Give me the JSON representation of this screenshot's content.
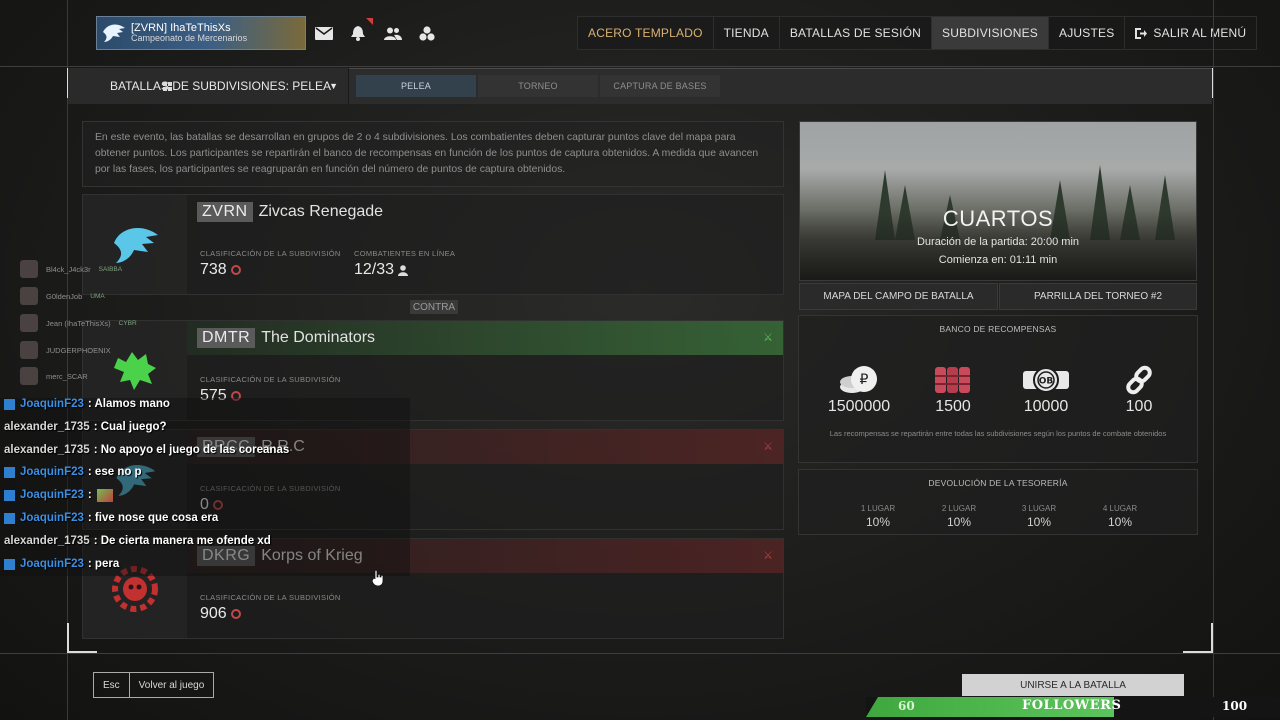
{
  "profile": {
    "nickname": "[ZVRN] IhaTeThisXs",
    "rank": "Campeonato de Mercenarios"
  },
  "nav": [
    "ACERO TEMPLADO",
    "TIENDA",
    "BATALLAS DE SESIÓN",
    "SUBDIVISIONES",
    "AJUSTES",
    "SALIR AL MENÚ"
  ],
  "event": {
    "dropdown": "BATALLAS DE SUBDIVISIONES: PELEA",
    "tabs": [
      "PELEA",
      "TORNEO",
      "CAPTURA DE BASES"
    ],
    "description": "En este evento, las batallas se desarrollan en grupos de 2 o 4 subdivisiones. Los combatientes deben capturar puntos clave del mapa para obtener puntos. Los participantes se repartirán el banco de recompensas en función de los puntos de captura obtenidos. A medida que avancen por las fases, los participantes se reagruparán en función del número de puntos de captura obtenidos."
  },
  "teams": [
    {
      "tag": "ZVRN",
      "name": "Zivcas Renegade",
      "rating_label": "CLASIFICACIÓN DE LA SUBDIVISIÓN",
      "rating": "738",
      "online_label": "COMBATIENTES EN LÍNEA",
      "online": "12/33"
    },
    {
      "tag": "DMTR",
      "name": "The Dominators",
      "rating_label": "CLASIFICACIÓN DE LA SUBDIVISIÓN",
      "rating": "575"
    },
    {
      "tag": "RRCC",
      "name": "R.R.C",
      "rating_label": "CLASIFICACIÓN DE LA SUBDIVISIÓN",
      "rating": "0"
    },
    {
      "tag": "DKRG",
      "name": "Korps of Krieg",
      "rating_label": "CLASIFICACIÓN DE LA SUBDIVISIÓN",
      "rating": "906"
    }
  ],
  "versus": "CONTRA",
  "stage": {
    "title": "CUARTOS",
    "duration": "Duración de la partida: 20:00 min",
    "start": "Comienza en: 01:11 min"
  },
  "buttons": {
    "map": "MAPA DEL CAMPO DE BATALLA",
    "bracket": "PARRILLA DEL TORNEO #2",
    "join": "UNIRSE A LA BATALLA"
  },
  "rewards": {
    "title": "BANCO DE RECOMPENSAS",
    "items": [
      {
        "icon": "coins-icon",
        "value": "1500000"
      },
      {
        "icon": "barrels-icon",
        "value": "1500"
      },
      {
        "icon": "ob-token-icon",
        "value": "10000"
      },
      {
        "icon": "chain-icon",
        "value": "100"
      }
    ],
    "note": "Las recompensas se repartirán entre todas las subdivisiones según los puntos de combate obtenidos"
  },
  "treasury": {
    "title": "DEVOLUCIÓN DE LA TESORERÍA",
    "places": [
      {
        "label": "1 LUGAR",
        "value": "10%"
      },
      {
        "label": "2 LUGAR",
        "value": "10%"
      },
      {
        "label": "3 LUGAR",
        "value": "10%"
      },
      {
        "label": "4 LUGAR",
        "value": "10%"
      }
    ]
  },
  "viewers": [
    {
      "name": "Bl4ck_J4ck3r",
      "badge": "SAIBBA"
    },
    {
      "name": "G0ldenJob",
      "badge": "UMA"
    },
    {
      "name": "Jean (IhaTeThisXs)",
      "badge": "CYBR"
    },
    {
      "name": "JUDGERPHOENIX",
      "badge": ""
    },
    {
      "name": "merc_SCAR",
      "badge": ""
    }
  ],
  "chat": [
    {
      "user": "JoaquinF23",
      "text": ": Alamos mano",
      "icon": true
    },
    {
      "user": "alexander_1735",
      "text": ": Cual juego?",
      "icon": false
    },
    {
      "user": "alexander_1735",
      "text": ": No apoyo el juego de las coreanas",
      "icon": false
    },
    {
      "user": "JoaquinF23",
      "text": ": ese no p",
      "icon": true
    },
    {
      "user": "JoaquinF23",
      "text": ":",
      "icon": true
    },
    {
      "user": "JoaquinF23",
      "text": ": five nose que cosa era",
      "icon": true
    },
    {
      "user": "alexander_1735",
      "text": ": De cierta manera me ofende xd",
      "icon": false
    },
    {
      "user": "JoaquinF23",
      "text": ": pera",
      "icon": true
    }
  ],
  "footer": {
    "esc": "Esc",
    "back": "Volver al juego"
  },
  "followers": {
    "label": "FOLLOWERS",
    "min": "60",
    "max": "100",
    "progress": 0.6
  },
  "colors": {
    "accent": "#d9b271",
    "friendly": "#3f8a3f",
    "enemy": "#7a2d2d",
    "follower_bar": "#4cb84c"
  }
}
